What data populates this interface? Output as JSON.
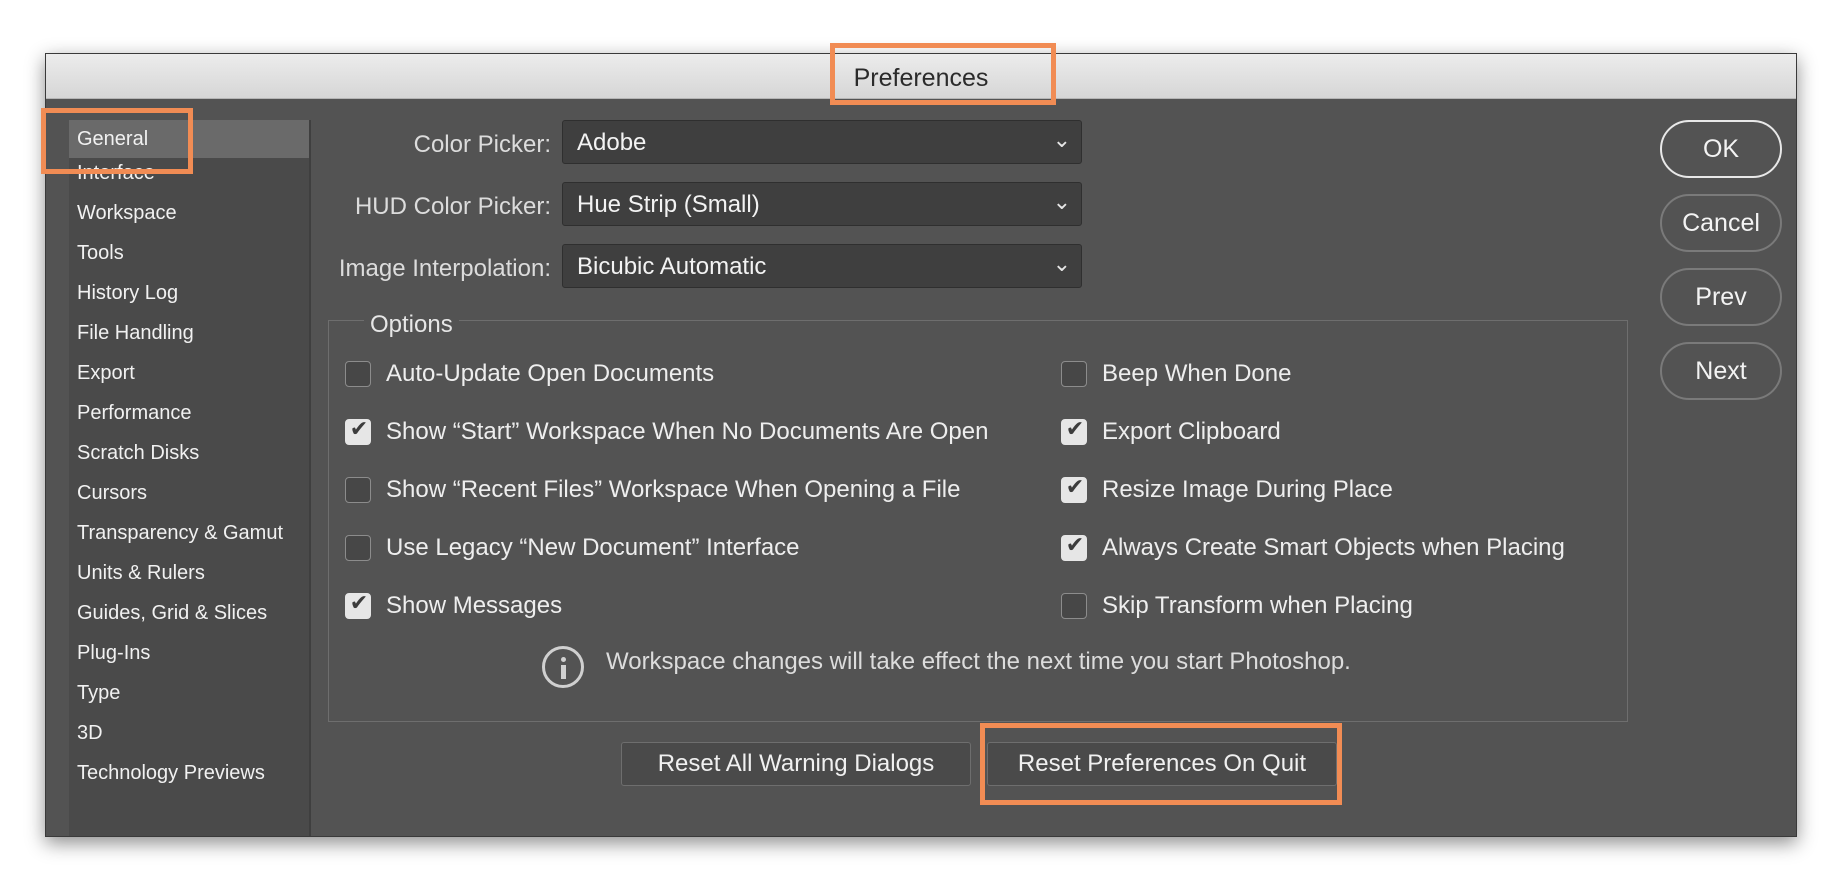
{
  "window": {
    "title": "Preferences"
  },
  "sidebar": {
    "items": [
      {
        "label": "General",
        "selected": true
      },
      {
        "label": "Interface"
      },
      {
        "label": "Workspace"
      },
      {
        "label": "Tools"
      },
      {
        "label": "History Log"
      },
      {
        "label": "File Handling"
      },
      {
        "label": "Export"
      },
      {
        "label": "Performance"
      },
      {
        "label": "Scratch Disks"
      },
      {
        "label": "Cursors"
      },
      {
        "label": "Transparency & Gamut"
      },
      {
        "label": "Units & Rulers"
      },
      {
        "label": "Guides, Grid & Slices"
      },
      {
        "label": "Plug-Ins"
      },
      {
        "label": "Type"
      },
      {
        "label": "3D"
      },
      {
        "label": "Technology Previews"
      }
    ]
  },
  "fields": {
    "color_picker": {
      "label": "Color Picker:",
      "value": "Adobe"
    },
    "hud_color_picker": {
      "label": "HUD Color Picker:",
      "value": "Hue Strip (Small)"
    },
    "image_interpolation": {
      "label": "Image Interpolation:",
      "value": "Bicubic Automatic"
    }
  },
  "options": {
    "title": "Options",
    "left": [
      {
        "label": "Auto-Update Open Documents",
        "checked": false
      },
      {
        "label": "Show “Start” Workspace When No Documents Are Open",
        "checked": true
      },
      {
        "label": "Show “Recent Files” Workspace When Opening a File",
        "checked": false
      },
      {
        "label": "Use Legacy “New Document” Interface",
        "checked": false
      },
      {
        "label": "Show Messages",
        "checked": true
      }
    ],
    "right": [
      {
        "label": "Beep When Done",
        "checked": false
      },
      {
        "label": "Export Clipboard",
        "checked": true
      },
      {
        "label": "Resize Image During Place",
        "checked": true
      },
      {
        "label": "Always Create Smart Objects when Placing",
        "checked": true
      },
      {
        "label": "Skip Transform when Placing",
        "checked": false
      }
    ],
    "check_glyph": "✔"
  },
  "info": {
    "icon": "info-icon",
    "text": "Workspace changes will take effect the next time you start Photoshop."
  },
  "buttons": {
    "reset_warnings": "Reset All Warning Dialogs",
    "reset_prefs": "Reset Preferences On Quit",
    "ok": "OK",
    "cancel": "Cancel",
    "prev": "Prev",
    "next": "Next"
  },
  "annotation_color": "#f18c54"
}
